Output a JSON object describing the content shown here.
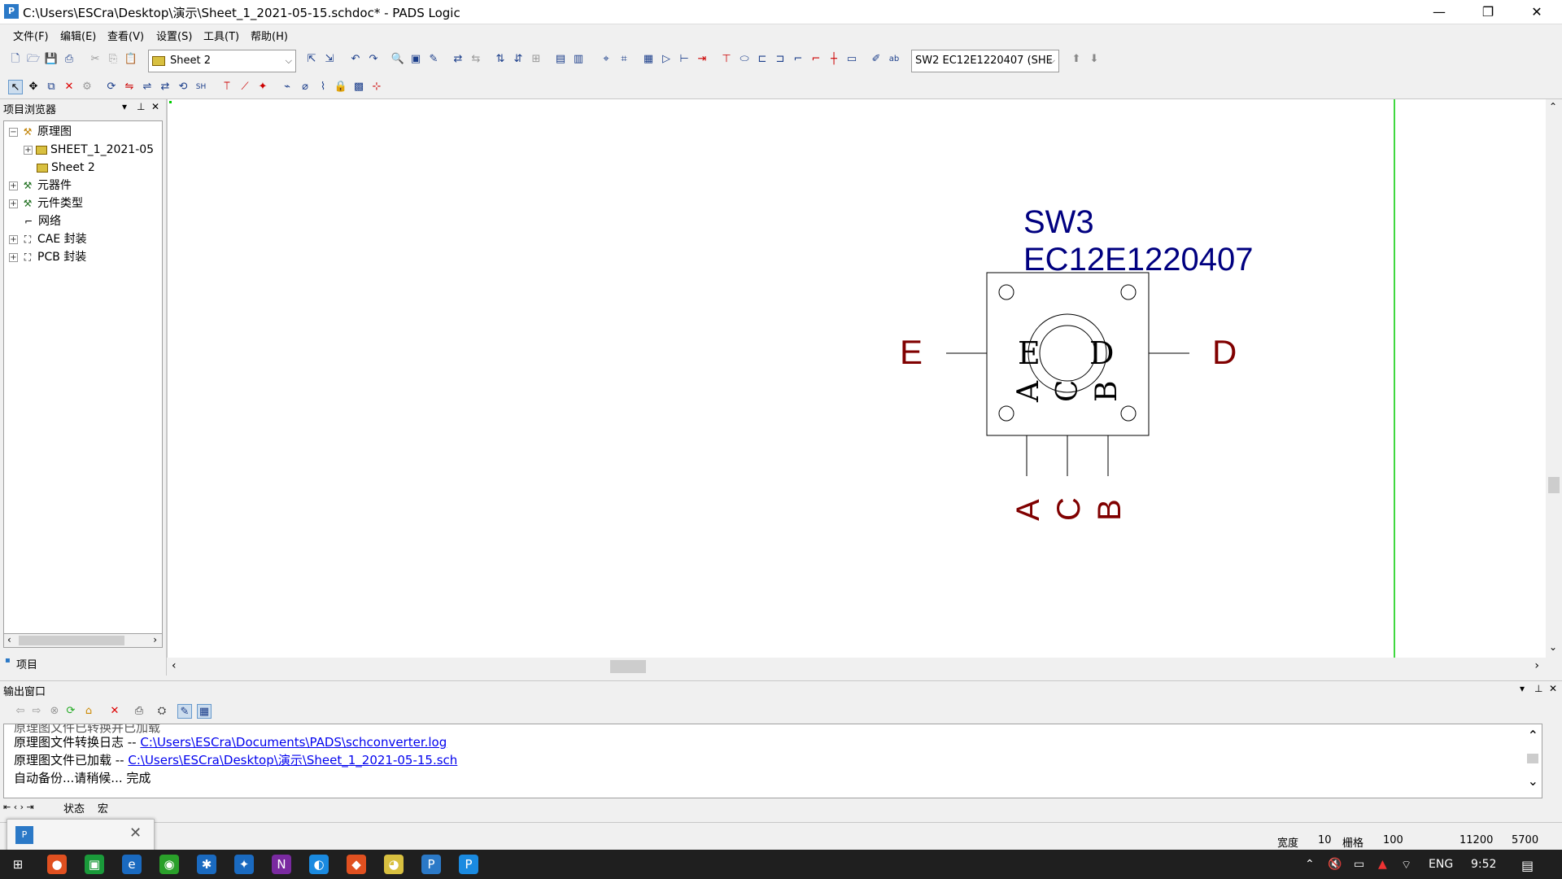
{
  "window": {
    "title": "C:\\Users\\ESCra\\Desktop\\演示\\Sheet_1_2021-05-15.schdoc* - PADS Logic",
    "minimize_icon": "minimize-icon",
    "restore_icon": "restore-icon",
    "close_icon": "close-icon"
  },
  "menu": [
    "文件(F)",
    "编辑(E)",
    "查看(V)",
    "设置(S)",
    "工具(T)",
    "帮助(H)"
  ],
  "toolbar": {
    "sheet_select": "Sheet 2",
    "part_select": "SW2 EC12E1220407 (SHE"
  },
  "project_browser": {
    "title": "项目浏览器",
    "tree": [
      {
        "label": "原理图",
        "level": 0,
        "expander": "−"
      },
      {
        "label": "SHEET_1_2021-05",
        "level": 1,
        "expander": "+"
      },
      {
        "label": "Sheet 2",
        "level": 1,
        "expander": ""
      },
      {
        "label": "元器件",
        "level": 0,
        "expander": "+"
      },
      {
        "label": "元件类型",
        "level": 0,
        "expander": "+"
      },
      {
        "label": "网络",
        "level": 0,
        "expander": ""
      },
      {
        "label": "CAE 封装",
        "level": 0,
        "expander": "+"
      },
      {
        "label": "PCB 封装",
        "level": 0,
        "expander": "+"
      }
    ],
    "tab": "项目"
  },
  "schematic": {
    "ref_des": "SW3",
    "part_value": "EC12E1220407",
    "pin_left": "E",
    "pin_right": "D",
    "pin_bottom": [
      "A",
      "C",
      "B"
    ],
    "body_labels": {
      "e": "E",
      "d": "D",
      "a": "A",
      "c": "C",
      "b": "B"
    },
    "line_color": "#000000",
    "label_color": "#000080",
    "pin_label_color": "#800000",
    "board_edge_color": "#00cc00"
  },
  "output_window": {
    "title": "输出窗口",
    "lines": [
      {
        "prefix": "原理图文件转换日志  -- ",
        "link": "C:\\Users\\ESCra\\Documents\\PADS\\schconverter.log"
      },
      {
        "prefix": "原理图文件已加载  -- ",
        "link": "C:\\Users\\ESCra\\Desktop\\演示\\Sheet_1_2021-05-15.sch"
      },
      {
        "prefix": "自动备份...请稍候...  完成",
        "link": ""
      }
    ],
    "tabs": [
      "状态",
      "宏"
    ]
  },
  "status": {
    "width_label": "宽度",
    "width_value": "10",
    "grid_label": "栅格",
    "grid_value": "100",
    "x": "11200",
    "y": "5700"
  },
  "taskbar": {
    "lang": "ENG",
    "time": "9:52"
  }
}
